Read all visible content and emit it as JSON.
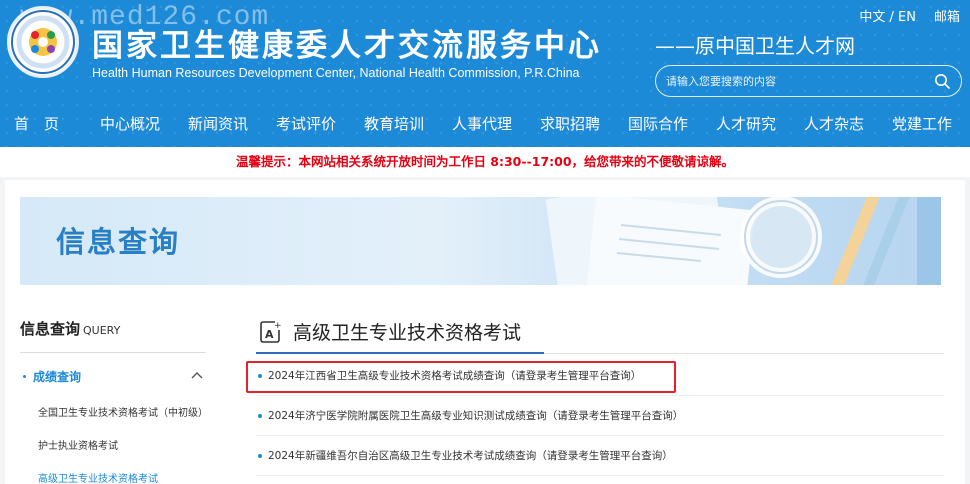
{
  "header": {
    "watermark": "www.med126.com",
    "title_cn": "国家卫生健康委人才交流服务中心",
    "title_en": "Health Human Resources Development Center, National Health Commission, P.R.China",
    "subtitle": "——原中国卫生人才网",
    "lang_link": "中文 / EN",
    "mail_link": "邮箱",
    "search_placeholder": "请输入您要搜索的内容"
  },
  "nav": {
    "items": [
      "首　页",
      "中心概况",
      "新闻资讯",
      "考试评价",
      "教育培训",
      "人事代理",
      "求职招聘",
      "国际合作",
      "人才研究",
      "人才杂志",
      "党建工作"
    ]
  },
  "notice": "温馨提示：本网站相关系统开放时间为工作日 8:30--17:00，给您带来的不便敬请谅解。",
  "banner": {
    "title": "信息查询"
  },
  "sidebar": {
    "title": "信息查询",
    "title_en": "QUERY",
    "category": "成绩查询",
    "subitems": [
      "全国卫生专业技术资格考试（中初级）",
      "护士执业资格考试",
      "高级卫生专业技术资格考试"
    ]
  },
  "content": {
    "title": "高级卫生专业技术资格考试",
    "items": [
      "2024年江西省卫生高级专业技术资格考试成绩查询（请登录考生管理平台查询）",
      "2024年济宁医学院附属医院卫生高级专业知识测试成绩查询（请登录考生管理平台查询）",
      "2024年新疆维吾尔自治区高级卫生专业技术考试成绩查询（请登录考生管理平台查询）"
    ]
  },
  "colors": {
    "brand_blue": "#1d8ad8",
    "notice_red": "#e60012",
    "highlight_red": "#e5222b"
  }
}
